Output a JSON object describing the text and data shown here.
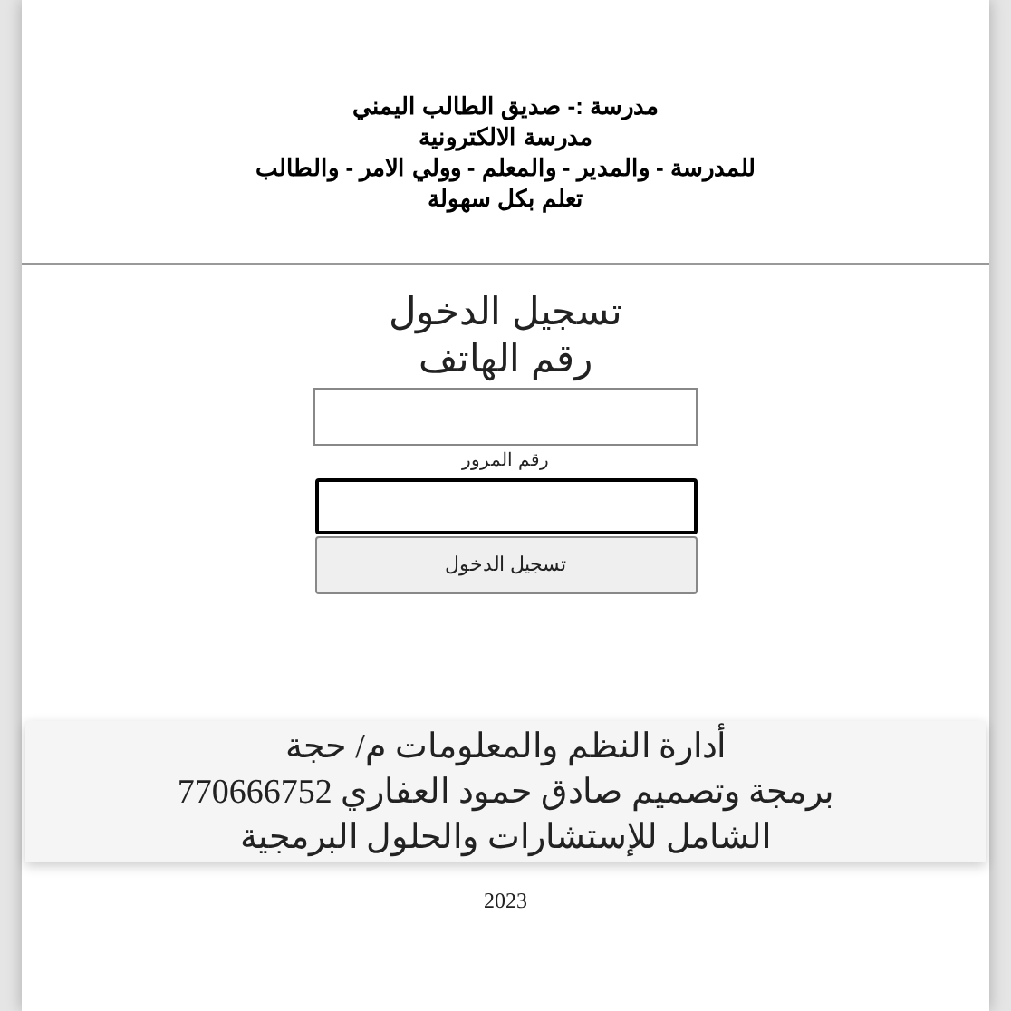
{
  "header": {
    "lines": [
      "مدرسة :- صديق الطالب اليمني",
      "مدرسة الالكترونية",
      "للمدرسة - والمدير - والمعلم - وولي الامر - والطالب",
      "تعلم بكل سهولة"
    ]
  },
  "login": {
    "title": "تسجيل الدخول",
    "phone_label": "رقم الهاتف",
    "password_label": "رقم المرور",
    "password_focused": true,
    "submit": "تسجيل الدخول"
  },
  "footer": {
    "lines": [
      "أدارة النظم والمعلومات م/ حجة",
      "برمجة وتصميم صادق حمود العفاري 770666752",
      "الشامل للإستشارات والحلول البرمجية"
    ],
    "year": "2023"
  }
}
